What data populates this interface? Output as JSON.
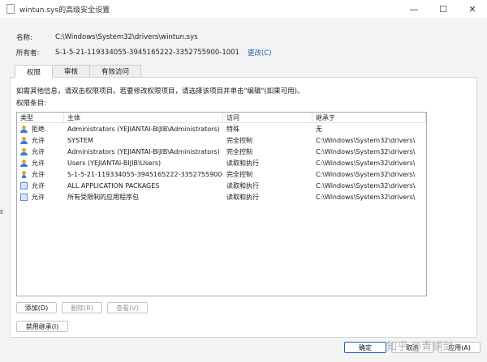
{
  "window": {
    "title": "wintun.sys的高级安全设置",
    "minimize": "—",
    "maximize": "☐",
    "close": "✕"
  },
  "fields": {
    "name_label": "名称:",
    "name_value": "C:\\Windows\\System32\\drivers\\wintun.sys",
    "owner_label": "所有者:",
    "owner_value": "S-1-5-21-119334055-3945165222-3352755900-1001",
    "owner_change": "更改(C)"
  },
  "tabs": [
    {
      "label": "权限",
      "active": true
    },
    {
      "label": "审核",
      "active": false
    },
    {
      "label": "有效访问",
      "active": false
    }
  ],
  "info_text": "如需其他信息，请双击权限项目。若要修改权限项目，请选择该项目并单击\"编辑\"(如果可用)。",
  "entries_label": "权限条目:",
  "columns": {
    "type": "类型",
    "principal": "主体",
    "access": "访问",
    "inherited_from": "继承于"
  },
  "rows": [
    {
      "icon": "user-group-icon",
      "type": "拒绝",
      "principal": "Administrators (YEJIANTAI-BIJIB\\Administrators)",
      "access": "特殊",
      "inherited_from": "无"
    },
    {
      "icon": "user-group-icon",
      "type": "允许",
      "principal": "SYSTEM",
      "access": "完全控制",
      "inherited_from": "C:\\Windows\\System32\\drivers\\"
    },
    {
      "icon": "user-group-icon",
      "type": "允许",
      "principal": "Administrators (YEJIANTAI-BIJIB\\Administrators)",
      "access": "完全控制",
      "inherited_from": "C:\\Windows\\System32\\drivers\\"
    },
    {
      "icon": "user-group-icon",
      "type": "允许",
      "principal": "Users (YEJIANTAI-BIJIB\\Users)",
      "access": "读取和执行",
      "inherited_from": "C:\\Windows\\System32\\drivers\\"
    },
    {
      "icon": "user-icon",
      "type": "允许",
      "principal": "S-1-5-21-119334055-3945165222-3352755900-...",
      "access": "完全控制",
      "inherited_from": "C:\\Windows\\System32\\drivers\\"
    },
    {
      "icon": "package-icon",
      "type": "允许",
      "principal": "ALL APPLICATION PACKAGES",
      "access": "读取和执行",
      "inherited_from": "C:\\Windows\\System32\\drivers\\"
    },
    {
      "icon": "package-icon",
      "type": "允许",
      "principal": "所有受限制的应用程序包",
      "access": "读取和执行",
      "inherited_from": "C:\\Windows\\System32\\drivers\\"
    }
  ],
  "buttons": {
    "add": "添加(D)",
    "remove": "删除(R)",
    "view": "查看(V)",
    "disable_inheritance": "禁用继承(I)",
    "ok": "确定",
    "cancel": "取消",
    "apply": "应用(A)"
  },
  "watermark": "知乎 @青铜剑",
  "left_edge_text": "E"
}
